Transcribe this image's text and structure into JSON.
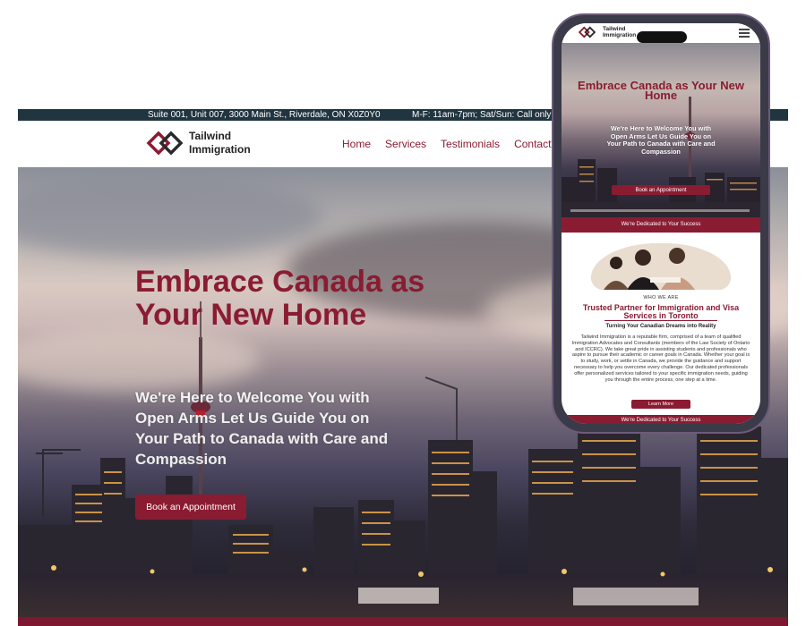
{
  "colors": {
    "brand": "#8a1c32",
    "topbar": "#213540",
    "white": "#ffffff"
  },
  "desktop": {
    "topbar": {
      "address": "Suite 001, Unit 007, 3000 Main St., Riverdale, ON X0Z0Y0",
      "hours": "M-F: 11am-7pm; Sat/Sun: Call only"
    },
    "logo": {
      "icon": "diamond-chain-logo-icon",
      "line1": "Tailwind",
      "line2": "Immigration"
    },
    "nav": [
      {
        "label": "Home"
      },
      {
        "label": "Services"
      },
      {
        "label": "Testimonials"
      },
      {
        "label": "Contact"
      }
    ],
    "hero": {
      "title": "Embrace Canada as Your New Home",
      "subtitle": "We're Here to Welcome You with Open Arms Let Us Guide You on Your Path to Canada with Care and Compassion",
      "button": "Book an Appointment"
    }
  },
  "mobile": {
    "logo": {
      "line1": "Tailwind",
      "line2": "Immigration"
    },
    "menu_icon": "hamburger-menu-icon",
    "hero": {
      "title": "Embrace Canada as Your New Home",
      "subtitle": "We're Here to Welcome You with Open Arms Let Us Guide You on Your Path to Canada with Care and Compassion",
      "button": "Book an Appointment"
    },
    "banner": "We're Dedicated to Your Success",
    "about": {
      "kicker": "WHO WE ARE",
      "heading": "Trusted Partner for Immigration and Visa Services in Toronto",
      "subheading": "Turning Your Canadian Dreams into Reality",
      "body": "Tailwind Immigration is a reputable firm, comprised of a team of qualified Immigration Advocates and Consultants (members of the Law Society of Ontario and ICCRC). We take great pride in assisting students and professionals who aspire to pursue their academic or career goals in Canada. Whether your goal is to study, work, or settle in Canada, we provide the guidance and support necessary to help you overcome every challenge. Our dedicated professionals offer personalized services tailored to your specific immigration needs, guiding you through the entire process, one step at a time.",
      "button": "Learn More"
    },
    "banner_bottom": "We're Dedicated to Your Success"
  }
}
